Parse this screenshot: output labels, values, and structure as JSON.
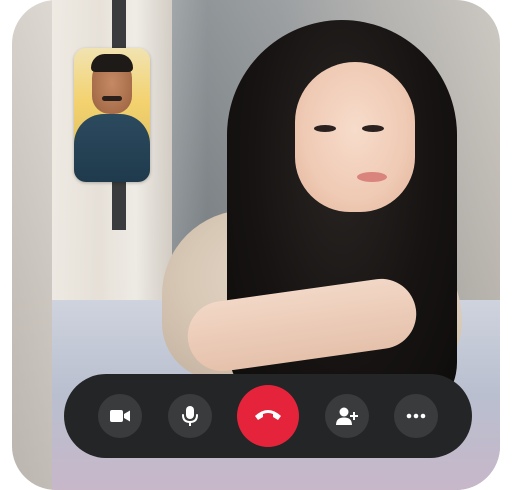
{
  "remote_video": {
    "description": ""
  },
  "self_view": {
    "description": ""
  },
  "controls": {
    "buttons": [
      {
        "name": "video",
        "icon": "video-camera-icon"
      },
      {
        "name": "microphone",
        "icon": "microphone-icon"
      },
      {
        "name": "end-call",
        "icon": "phone-hangup-icon",
        "color": "#e5243b"
      },
      {
        "name": "add-person",
        "icon": "add-person-icon"
      },
      {
        "name": "more",
        "icon": "more-icon"
      }
    ],
    "bar_color": "#242526",
    "button_color": "#3a3b3c"
  }
}
